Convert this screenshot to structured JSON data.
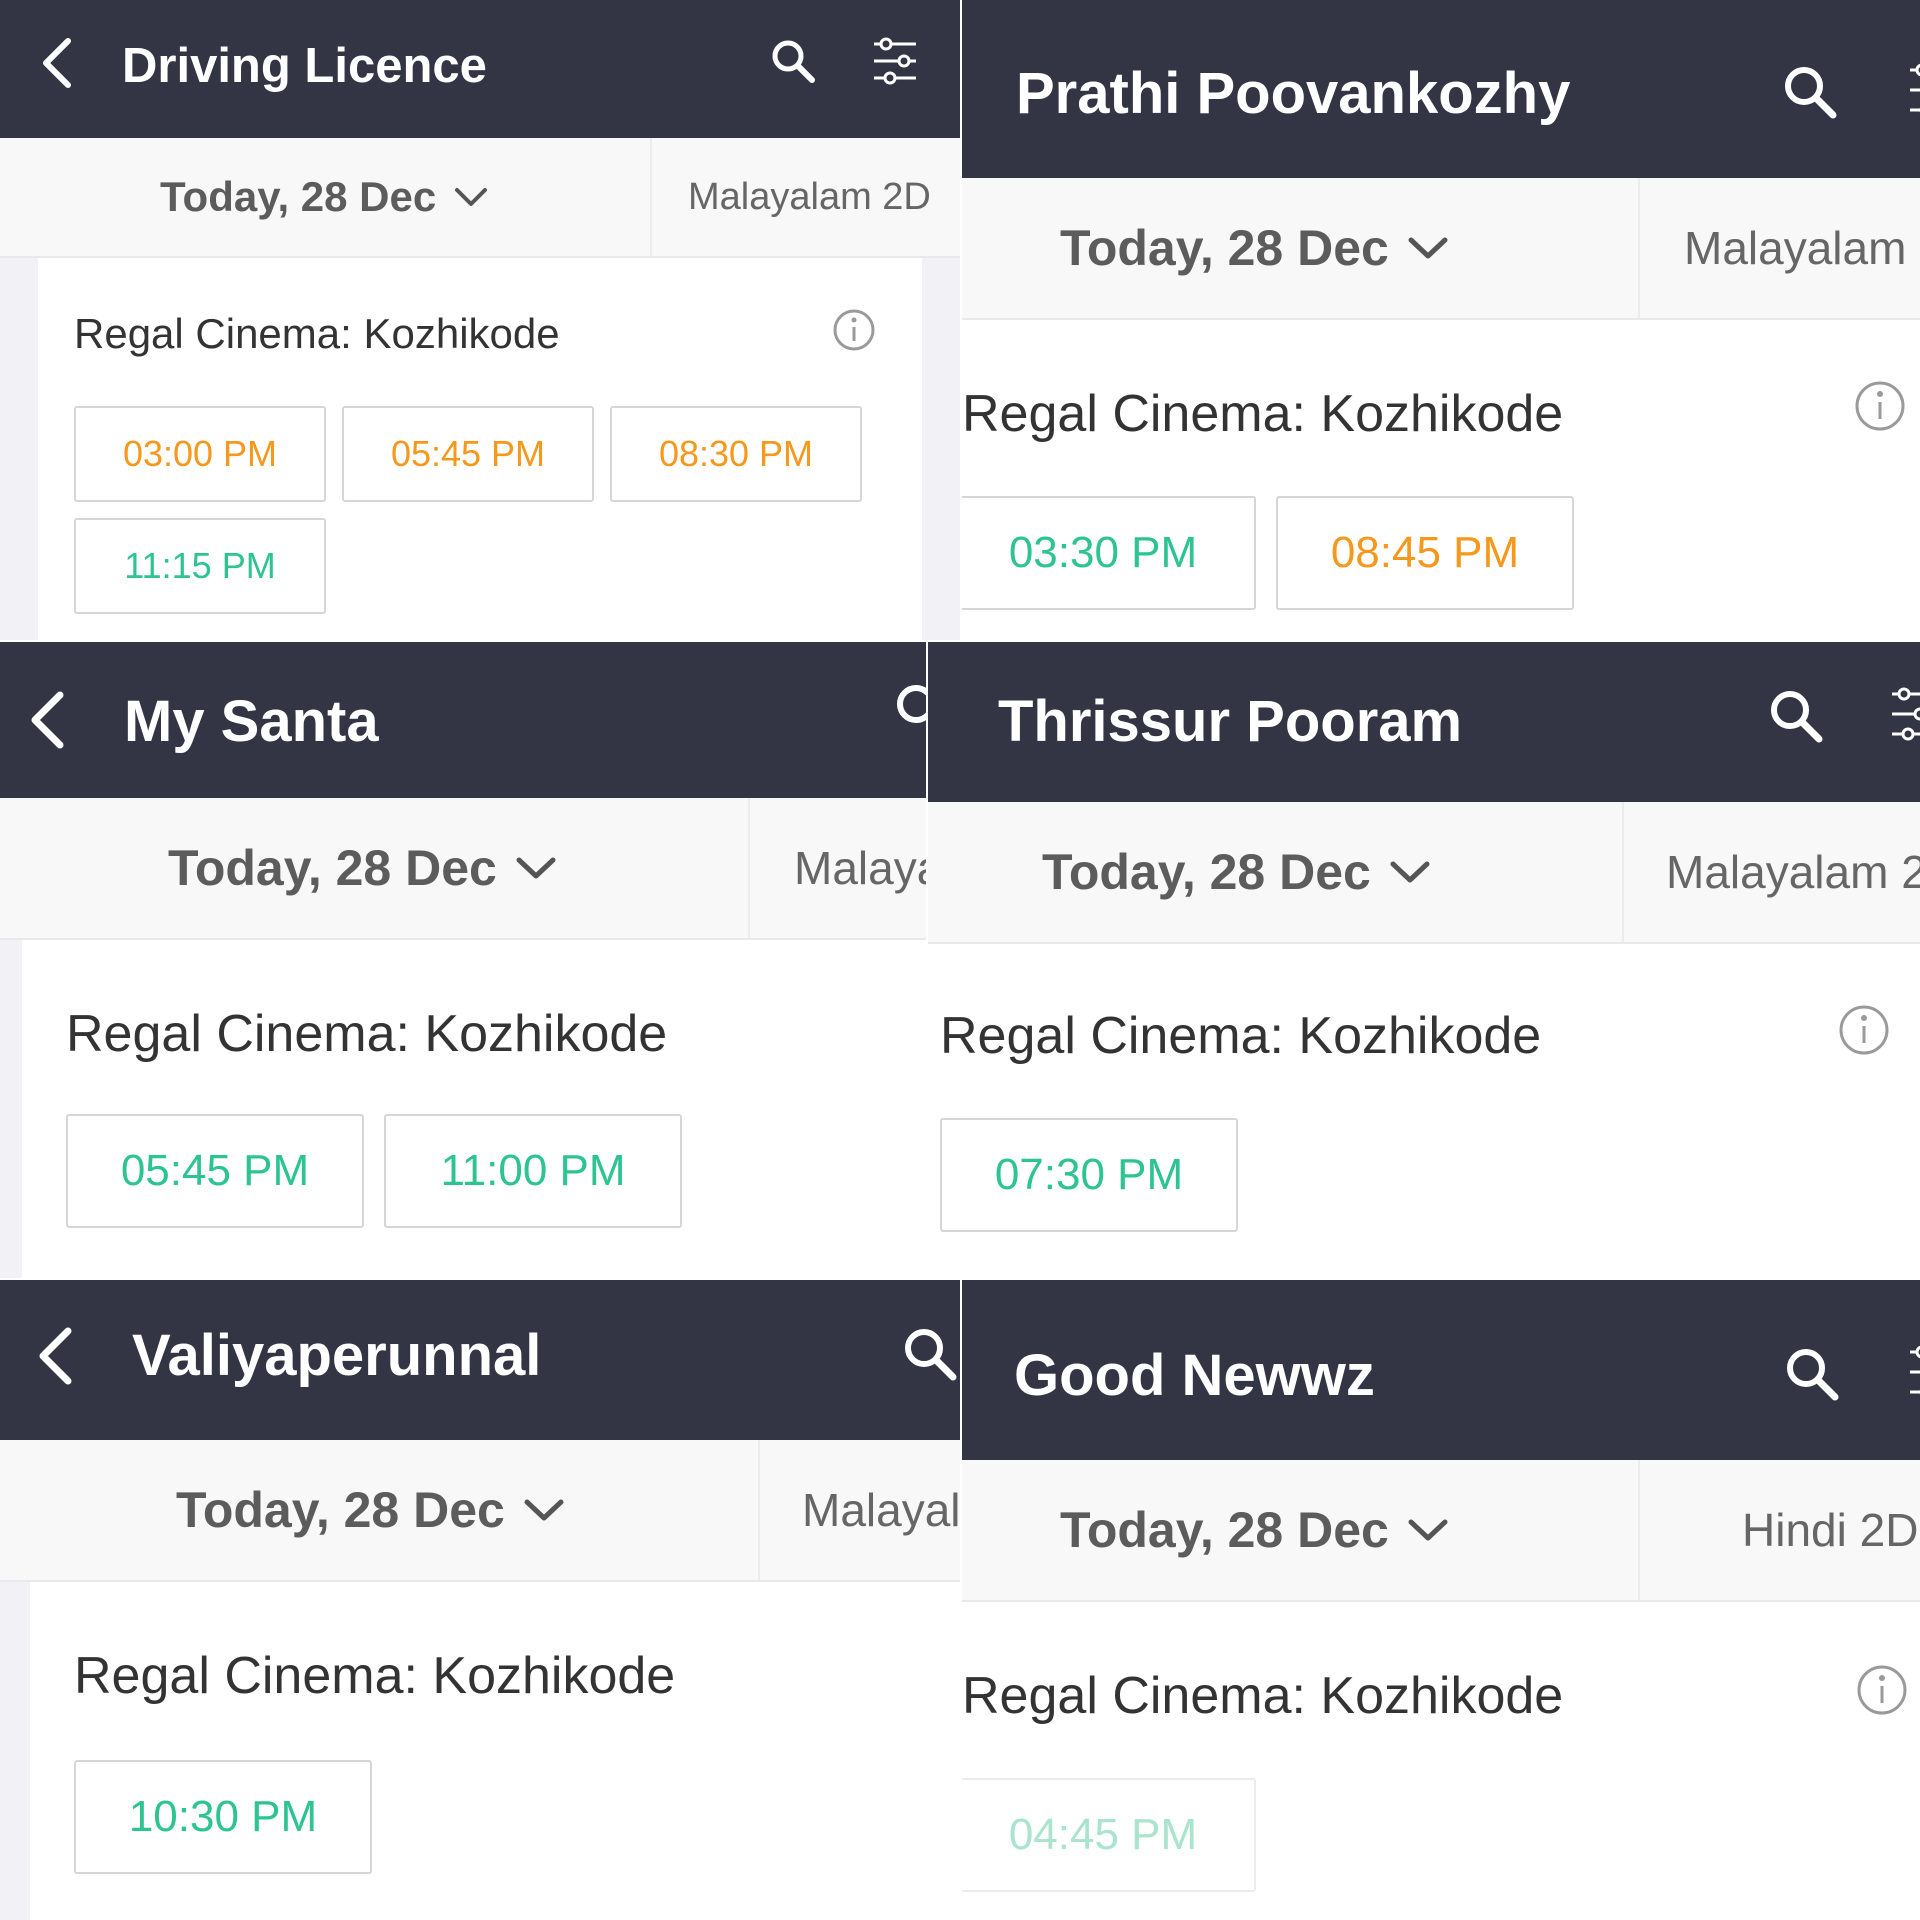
{
  "common": {
    "date_label": "Today, 28 Dec",
    "cinema_name": "Regal Cinema: Kozhikode",
    "colors": {
      "header_bg": "#333545",
      "showtime_filling_fast": "#f6981c",
      "showtime_available": "#2dc492"
    },
    "icons": [
      "back-arrow-icon",
      "search-icon",
      "filter-sliders-icon",
      "chevron-down-icon",
      "info-icon"
    ]
  },
  "panels": [
    {
      "movie_title": "Driving Licence",
      "language": "Malayalam 2D",
      "showtimes": [
        {
          "time": "03:00 PM",
          "status": "filling-fast"
        },
        {
          "time": "05:45 PM",
          "status": "filling-fast"
        },
        {
          "time": "08:30 PM",
          "status": "filling-fast"
        },
        {
          "time": "11:15 PM",
          "status": "available"
        }
      ]
    },
    {
      "movie_title": "Prathi Poovankozhy",
      "language": "Malayalam",
      "showtimes": [
        {
          "time": "03:30 PM",
          "status": "available"
        },
        {
          "time": "08:45 PM",
          "status": "filling-fast"
        }
      ]
    },
    {
      "movie_title": "My Santa",
      "language": "Malaya",
      "showtimes": [
        {
          "time": "05:45 PM",
          "status": "available"
        },
        {
          "time": "11:00 PM",
          "status": "available"
        }
      ]
    },
    {
      "movie_title": "Thrissur Pooram",
      "language": "Malayalam 2",
      "showtimes": [
        {
          "time": "07:30 PM",
          "status": "available"
        }
      ]
    },
    {
      "movie_title": "Valiyaperunnal",
      "language": "Malayal",
      "showtimes": [
        {
          "time": "10:30 PM",
          "status": "available"
        }
      ]
    },
    {
      "movie_title": "Good Newwz",
      "language": "Hindi 2D",
      "showtimes": [
        {
          "time": "04:45 PM",
          "status": "available"
        }
      ]
    }
  ]
}
